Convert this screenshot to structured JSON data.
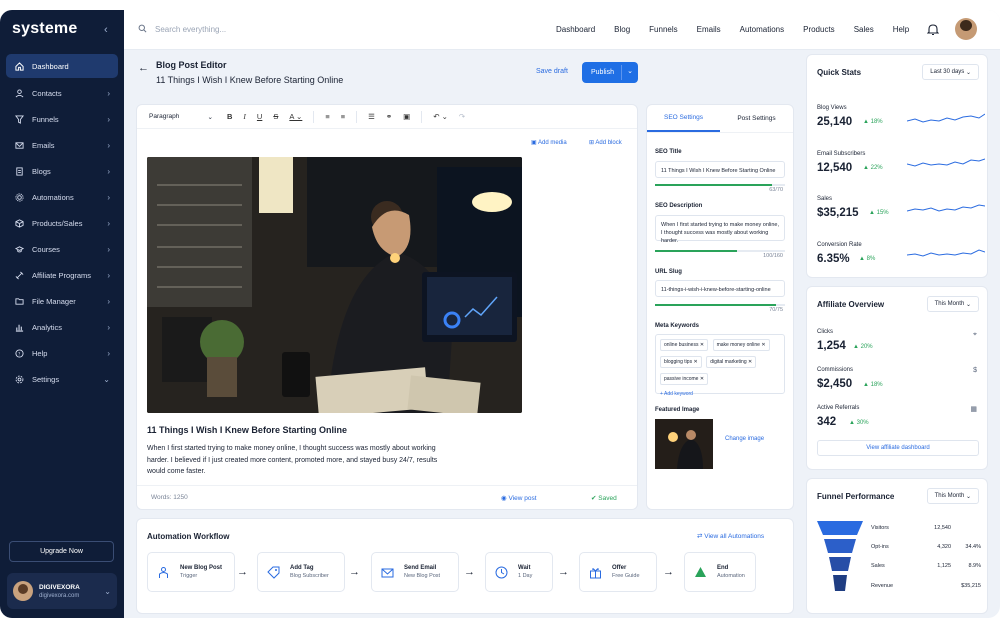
{
  "app": {
    "logo": "systeme"
  },
  "sidebar": {
    "items": [
      {
        "label": "Dashboard",
        "icon": "home-icon",
        "active": true,
        "chevron": ""
      },
      {
        "label": "Contacts",
        "icon": "user-icon",
        "chevron": "›"
      },
      {
        "label": "Funnels",
        "icon": "funnel-icon",
        "chevron": "›"
      },
      {
        "label": "Emails",
        "icon": "mail-icon",
        "chevron": "›"
      },
      {
        "label": "Blogs",
        "icon": "document-icon",
        "chevron": "›"
      },
      {
        "label": "Automations",
        "icon": "gear-icon",
        "chevron": "›"
      },
      {
        "label": "Products/Sales",
        "icon": "box-icon",
        "chevron": "›"
      },
      {
        "label": "Courses",
        "icon": "cap-icon",
        "chevron": "›"
      },
      {
        "label": "Affiliate Programs",
        "icon": "link-icon",
        "chevron": "›"
      },
      {
        "label": "File Manager",
        "icon": "folder-icon",
        "chevron": "›"
      },
      {
        "label": "Analytics",
        "icon": "chart-icon",
        "chevron": "›"
      },
      {
        "label": "Help",
        "icon": "help-icon",
        "chevron": "›"
      },
      {
        "label": "Settings",
        "icon": "settings-icon",
        "chevron": "⌄"
      }
    ],
    "upgrade": "Upgrade Now",
    "user": {
      "name": "DIGIVEXORA",
      "email": "digivexora.com"
    }
  },
  "topbar": {
    "search_placeholder": "Search everything...",
    "nav": [
      "Dashboard",
      "Blog",
      "Funnels",
      "Emails",
      "Automations",
      "Products",
      "Sales",
      "Help"
    ]
  },
  "editor": {
    "page_title": "Blog Post Editor",
    "post_heading": "11 Things I Wish I Knew Before Starting Online",
    "save_draft": "Save draft",
    "publish": "Publish",
    "paragraph_style": "Paragraph",
    "add_media": "Add media",
    "add_block": "Add block",
    "post_title": "11 Things I Wish I Knew Before Starting Online",
    "post_body": "When I first started trying to make money online, I thought success was mostly about working harder. I believed if I just created more content, promoted more, and stayed busy 24/7, results would come faster.",
    "words": "Words: 1250",
    "view_post": "View post",
    "saved": "Saved"
  },
  "seo": {
    "tabs": [
      "SEO Settings",
      "Post Settings"
    ],
    "title_label": "SEO Title",
    "title_value": "11 Things I Wish I Knew Before Starting Online",
    "title_count": "63/70",
    "title_progress": 0.9,
    "desc_label": "SEO Description",
    "desc_value": "When I first started trying to make money online, I thought success was mostly about working harder.",
    "desc_count": "100/160",
    "desc_progress": 0.63,
    "slug_label": "URL Slug",
    "slug_value": "11-things-i-wish-i-knew-before-starting-online",
    "slug_count": "70/75",
    "slug_progress": 0.93,
    "keywords_label": "Meta Keywords",
    "keywords": [
      "online business",
      "make money online",
      "blogging tips",
      "digital marketing",
      "passive income"
    ],
    "add_keyword": "+ Add keyword",
    "featured_label": "Featured Image",
    "change_image": "Change image"
  },
  "workflow": {
    "title": "Automation Workflow",
    "view_all": "View all Automations",
    "steps": [
      {
        "name": "New Blog Post",
        "sub": "Trigger",
        "icon": "person-icon"
      },
      {
        "name": "Add Tag",
        "sub": "Blog Subscriber",
        "icon": "tag-icon"
      },
      {
        "name": "Send Email",
        "sub": "New Blog Post",
        "icon": "mail-icon"
      },
      {
        "name": "Wait",
        "sub": "1 Day",
        "icon": "clock-icon"
      },
      {
        "name": "Offer",
        "sub": "Free Guide",
        "icon": "gift-icon"
      },
      {
        "name": "End",
        "sub": "Automation",
        "icon": "end-icon"
      }
    ]
  },
  "quick_stats": {
    "title": "Quick Stats",
    "period": "Last 30 days",
    "items": [
      {
        "label": "Blog Views",
        "value": "25,140",
        "change": "18%"
      },
      {
        "label": "Email Subscribers",
        "value": "12,540",
        "change": "22%"
      },
      {
        "label": "Sales",
        "value": "$35,215",
        "change": "15%"
      },
      {
        "label": "Conversion Rate",
        "value": "6.35%",
        "change": "8%"
      }
    ]
  },
  "affiliate": {
    "title": "Affiliate Overview",
    "period": "This Month",
    "items": [
      {
        "label": "Clicks",
        "value": "1,254",
        "change": "20%"
      },
      {
        "label": "Commissions",
        "value": "$2,450",
        "change": "18%"
      },
      {
        "label": "Active Referrals",
        "value": "342",
        "change": "30%"
      }
    ],
    "button": "View affiliate dashboard"
  },
  "funnel": {
    "title": "Funnel Performance",
    "period": "This Month",
    "rows": [
      {
        "name": "Visitors",
        "value": "12,540",
        "pct": ""
      },
      {
        "name": "Opt-ins",
        "value": "4,320",
        "pct": "34.4%"
      },
      {
        "name": "Sales",
        "value": "1,125",
        "pct": "8.9%"
      },
      {
        "name": "Revenue",
        "value": "$35,215",
        "pct": ""
      }
    ]
  },
  "colors": {
    "sidebar": "#0f1d38",
    "accent": "#1f6fe5",
    "positive": "#2aa35a"
  }
}
